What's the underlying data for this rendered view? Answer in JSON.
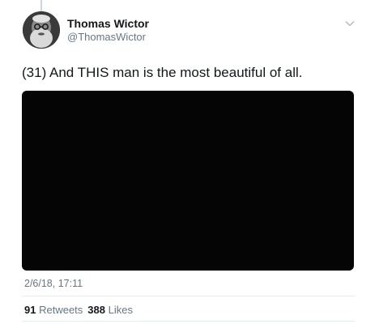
{
  "tweet": {
    "author_name": "Thomas Wictor",
    "author_handle": "@ThomasWictor",
    "text": "(31) And THIS man is the most beautiful of all.",
    "timestamp": "2/6/18, 17:11",
    "retweets_count": "91",
    "retweets_label": "Retweets",
    "likes_count": "388",
    "likes_label": "Likes"
  },
  "icons": {
    "menu": "chevron-down-icon",
    "avatar": "avatar"
  },
  "colors": {
    "text": "#14171a",
    "secondary_text": "#657786",
    "divider": "#e6ecf0",
    "media_background": "#050505"
  }
}
